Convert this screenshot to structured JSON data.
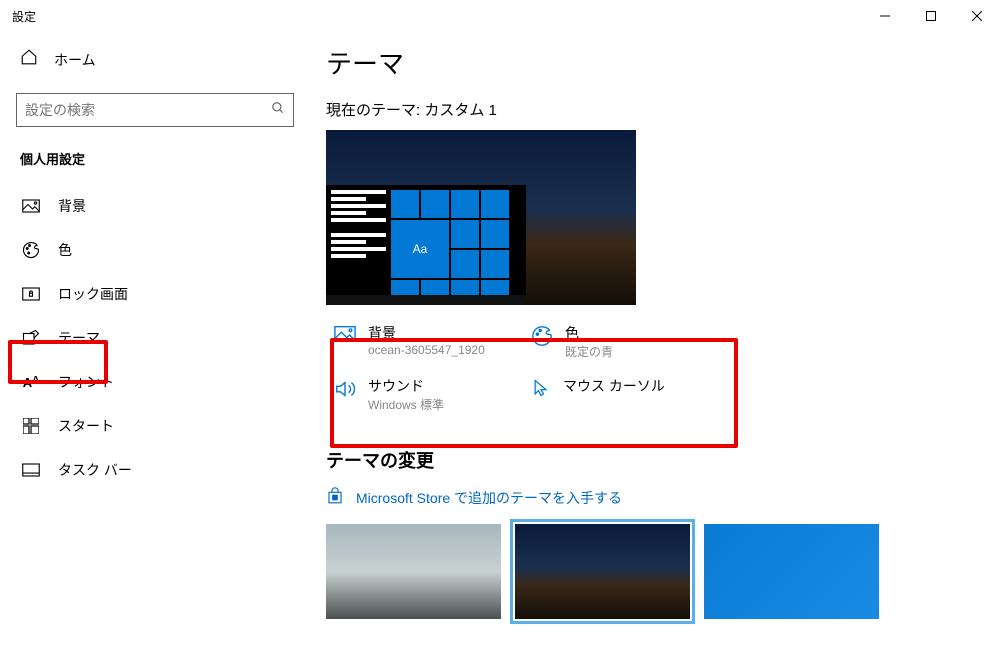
{
  "window": {
    "title": "設定"
  },
  "sidebar": {
    "home": "ホーム",
    "search_placeholder": "設定の検索",
    "section": "個人用設定",
    "items": [
      {
        "label": "背景"
      },
      {
        "label": "色"
      },
      {
        "label": "ロック画面"
      },
      {
        "label": "テーマ"
      },
      {
        "label": "フォント"
      },
      {
        "label": "スタート"
      },
      {
        "label": "タスク バー"
      }
    ]
  },
  "main": {
    "title": "テーマ",
    "current_label": "現在のテーマ: カスタム 1",
    "preview_accent_text": "Aa",
    "settings": [
      {
        "title": "背景",
        "sub": "ocean-3605547_1920"
      },
      {
        "title": "色",
        "sub": "既定の青"
      },
      {
        "title": "サウンド",
        "sub": "Windows 標準"
      },
      {
        "title": "マウス カーソル",
        "sub": ""
      }
    ],
    "change_heading": "テーマの変更",
    "store_link": "Microsoft Store で追加のテーマを入手する"
  }
}
